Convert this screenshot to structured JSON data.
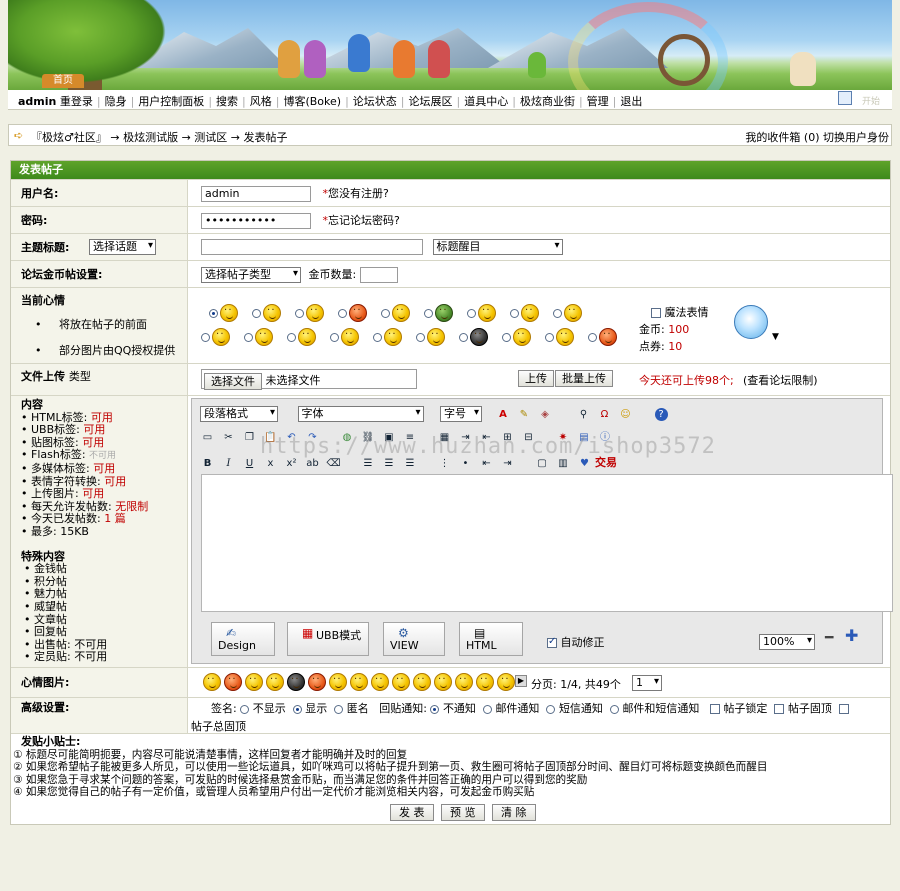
{
  "banner": {
    "home_tab": "首页"
  },
  "nav": {
    "user": "admin",
    "items": [
      "重登录",
      "隐身",
      "用户控制面板",
      "搜索",
      "风格",
      "博客(Boke)",
      "论坛状态",
      "论坛展区",
      "道具中心",
      "极炫商业街",
      "管理",
      "退出"
    ],
    "book_label": "开始"
  },
  "breadcrumb": {
    "path": "『极炫♂社区』 → 极炫测试版 → 测试区 → 发表帖子",
    "right": "我的收件箱 (0)  切换用户身份"
  },
  "form": {
    "title": "发表帖子",
    "username_label": "用户名:",
    "username_value": "admin",
    "not_registered": "您没有注册?",
    "password_label": "密码:",
    "password_value": "•••••••••••",
    "forgot_password": "忘记论坛密码?",
    "subject_label": "主题标题:",
    "topic_select": "选择话题",
    "title_color_select": "标题醒目",
    "coin_label": "论坛金币帖设置:",
    "coin_type_select": "选择帖子类型",
    "coin_amount_label": "金币数量:",
    "mood_label": "当前心情",
    "mood_notes": [
      "将放在帖子的前面",
      "部分图片由QQ授权提供"
    ],
    "magic_label": "魔法表情",
    "gold_label": "金币:",
    "gold_value": "100",
    "points_label": "点券:",
    "points_value": "10",
    "upload_label": "文件上传",
    "upload_type": "类型",
    "choose_file": "选择文件",
    "no_file": "未选择文件",
    "upload_btn": "上传",
    "batch_upload_btn": "批量上传",
    "upload_remaining": "今天还可上传98个;",
    "upload_limit": "(查看论坛限制)",
    "content_label": "内容",
    "content_rules": [
      {
        "k": "HTML标签:",
        "v": "可用",
        "c": "red"
      },
      {
        "k": "UBB标签:",
        "v": "可用",
        "c": "red"
      },
      {
        "k": "贴图标签:",
        "v": "可用",
        "c": "red"
      },
      {
        "k": "Flash标签:",
        "v": "不可用",
        "c": "gray"
      },
      {
        "k": "多媒体标签:",
        "v": "可用",
        "c": "red"
      },
      {
        "k": "表情字符转换:",
        "v": "可用",
        "c": "red"
      },
      {
        "k": "上传图片:",
        "v": "可用",
        "c": "red"
      },
      {
        "k": "每天允许发帖数:",
        "v": "无限制",
        "c": "red"
      },
      {
        "k": "今天已发帖数:",
        "v": "1 篇",
        "c": "mix"
      },
      {
        "k": "最多:",
        "v": "15KB",
        "c": "black"
      }
    ],
    "special_label": "特殊内容",
    "special_items": [
      "金钱帖",
      "积分帖",
      "魅力帖",
      "威望帖",
      "文章帖",
      "回复帖",
      "出售帖:  不可用",
      "定员贴:  不可用"
    ],
    "editor": {
      "format_select": "段落格式",
      "font_select": "字体",
      "size_select": "字号",
      "trade_label": "交易",
      "modes": [
        "Design",
        "UBB模式",
        "VIEW",
        "HTML"
      ],
      "auto_fix": "自动修正",
      "zoom": "100%"
    },
    "mood_img_label": "心情图片:",
    "paging": "分页: 1/4, 共49个",
    "page_select": "1",
    "advanced_label": "高级设置:",
    "sign_label": "签名:",
    "sign_options": [
      "不显示",
      "显示",
      "匿名"
    ],
    "reply_notify_label": "回贴通知:",
    "notify_options": [
      "不通知",
      "邮件通知",
      "短信通知",
      "邮件和短信通知"
    ],
    "lock_label": "帖子锁定",
    "pin_label": "帖子固顶",
    "global_pin_label": "帖子总固顶",
    "tips_title": "发贴小贴士:",
    "tips": [
      "① 标题尽可能简明扼要，内容尽可能说清楚事情，这样回复者才能明确并及时的回复",
      "② 如果您希望帖子能被更多人所见，可以使用一些论坛道具，如吖咪鸡可以将帖子提升到第一页、救生圈可将帖子固顶部分时间、醒目灯可将标题变换颜色而醒目",
      "③ 如果您急于寻求某个问题的答案，可发贴的时候选择悬赏金币贴，而当满足您的条件并回答正确的用户可以得到您的奖励",
      "④ 如果您觉得自己的帖子有一定价值，或管理人员希望用户付出一定代价才能浏览相关内容，可发起金币购买贴"
    ]
  },
  "buttons": {
    "submit": "发 表",
    "preview": "预 览",
    "clear": "清 除"
  },
  "watermark": "https://www.huzhan.com/ishop3572"
}
